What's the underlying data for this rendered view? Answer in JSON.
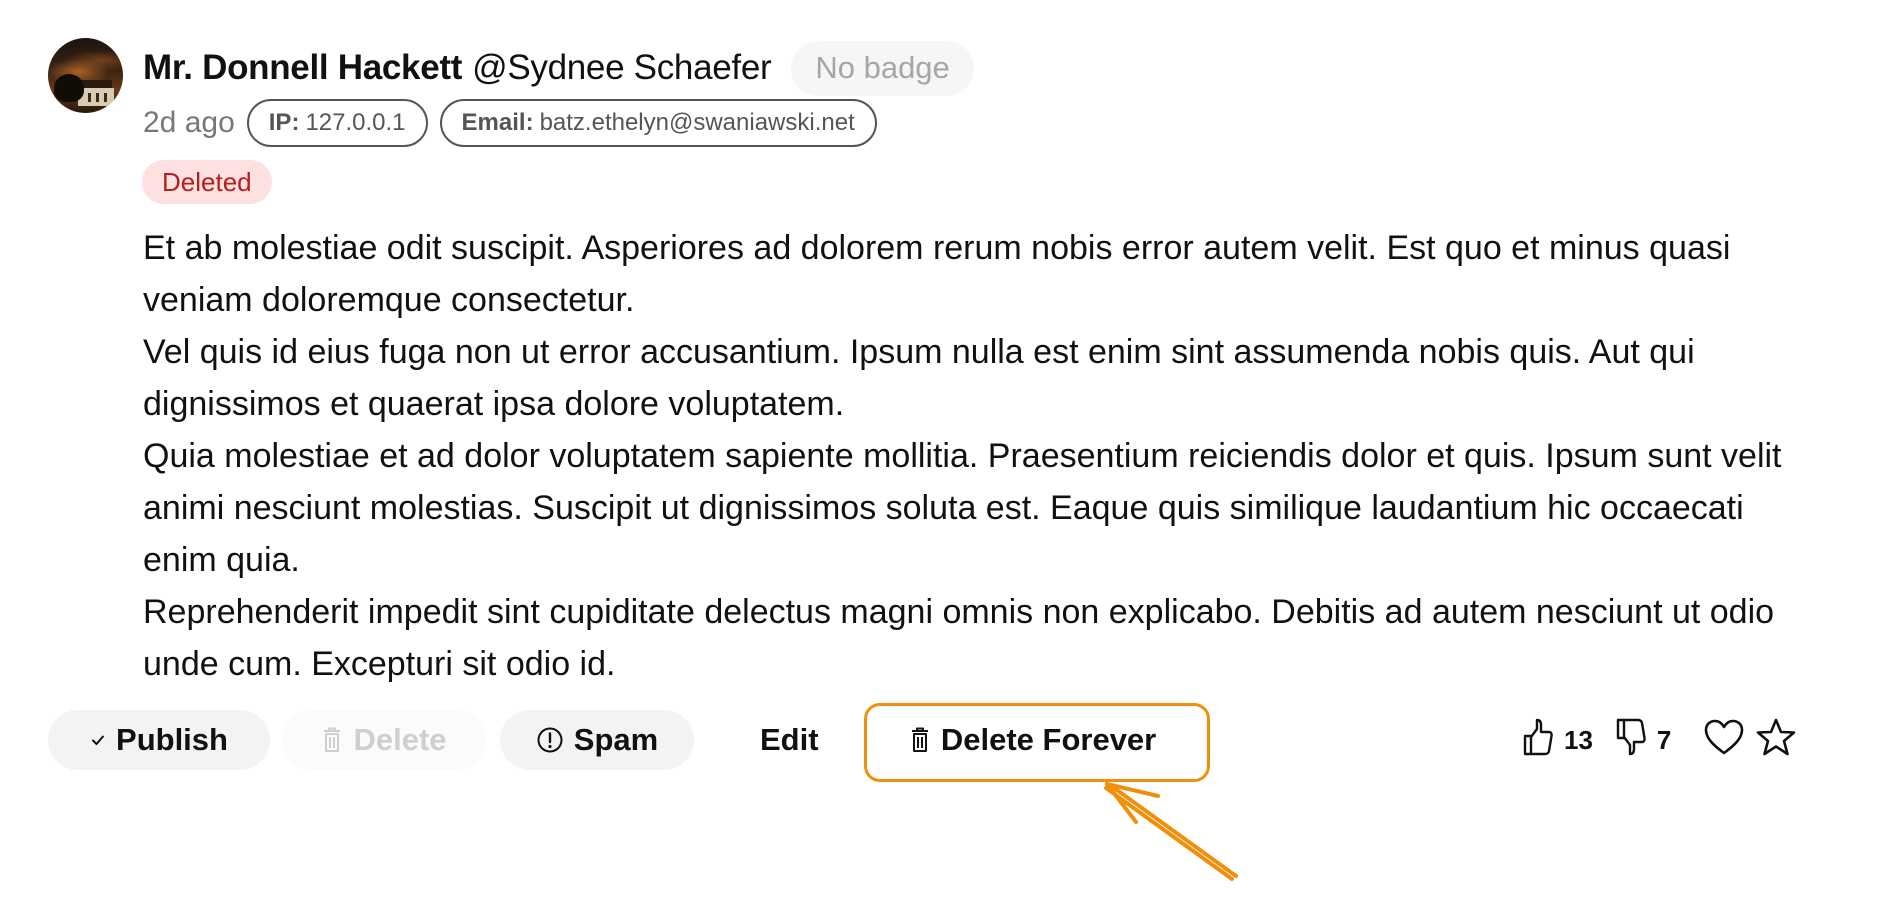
{
  "comment": {
    "author_name": "Mr. Donnell Hackett",
    "author_handle": "@Sydnee Schaefer",
    "badge": "No badge",
    "time_ago": "2d ago",
    "ip": {
      "key": "IP:",
      "value": "127.0.0.1"
    },
    "email": {
      "key": "Email:",
      "value": "batz.ethelyn@swaniawski.net"
    },
    "status": "Deleted",
    "paragraphs": [
      "Et ab molestiae odit suscipit. Asperiores ad dolorem rerum nobis error autem velit. Est quo et minus quasi veniam doloremque consectetur.",
      "Vel quis id eius fuga non ut error accusantium. Ipsum nulla est enim sint assumenda nobis quis. Aut qui dignissimos et quaerat ipsa dolore voluptatem.",
      "Quia molestiae et ad dolor voluptatem sapiente mollitia. Praesentium reiciendis dolor et quis. Ipsum sunt velit animi nesciunt molestias. Suscipit ut dignissimos soluta est. Eaque quis similique laudantium hic occaecati enim quia.",
      "Reprehenderit impedit sint cupiditate delectus magni omnis non explicabo. Debitis ad autem nesciunt ut odio unde cum. Excepturi sit odio id."
    ]
  },
  "actions": {
    "publish": {
      "label": "Publish",
      "icon": "check-icon"
    },
    "delete": {
      "label": "Delete",
      "icon": "trash-icon",
      "disabled": true
    },
    "spam": {
      "label": "Spam",
      "icon": "exclamation-circle-icon"
    },
    "edit": {
      "label": "Edit"
    },
    "delete_forever": {
      "label": "Delete Forever",
      "icon": "trash-icon"
    }
  },
  "reactions": {
    "likes": "13",
    "dislikes": "7"
  },
  "annotation": {
    "color": "#f0900a",
    "target": "delete-forever-button"
  },
  "colors": {
    "status_bg": "#fde1e1",
    "status_text": "#b91c1c",
    "button_bg": "#f3f3f3"
  }
}
